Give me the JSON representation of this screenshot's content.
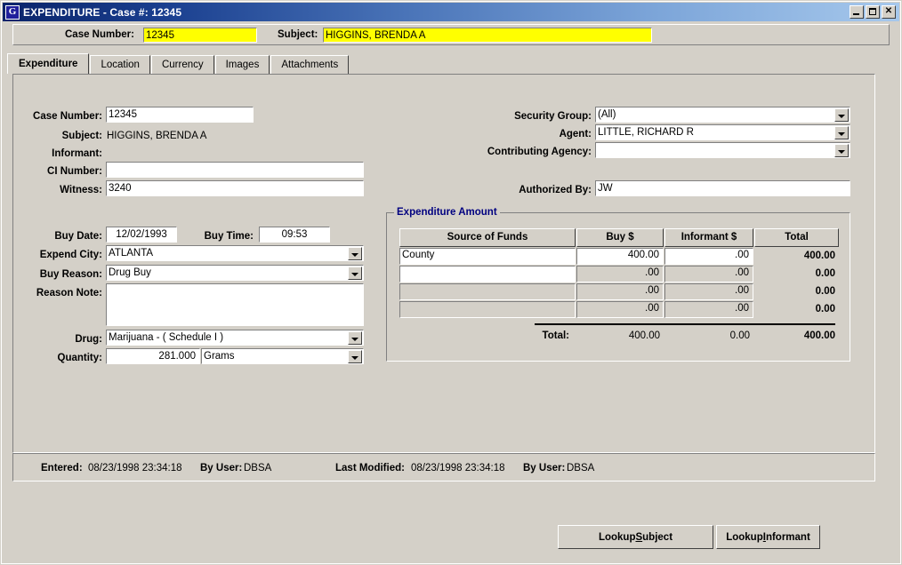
{
  "window": {
    "title": "EXPENDITURE - Case #: 12345",
    "icon": "app-g-icon",
    "minimize_label": "Minimize",
    "maximize_label": "Maximize",
    "close_label": "Close",
    "titlebar_color_left": "#0a246a",
    "titlebar_color_right": "#a6c8ec",
    "face_color": "#d4d0c8",
    "highlight_color": "#ffff00",
    "group_label_color": "#000080"
  },
  "header": {
    "case_number_label": "Case Number:",
    "case_number_value": "12345",
    "subject_label": "Subject:",
    "subject_value": "HIGGINS, BRENDA A"
  },
  "tabs": [
    {
      "label": "Expenditure",
      "active": true
    },
    {
      "label": "Location",
      "active": false
    },
    {
      "label": "Currency",
      "active": false
    },
    {
      "label": "Images",
      "active": false
    },
    {
      "label": "Attachments",
      "active": false
    }
  ],
  "form_left": {
    "case_number_label": "Case Number:",
    "case_number_value": "12345",
    "subject_label": "Subject:",
    "subject_value": "HIGGINS, BRENDA A",
    "informant_label": "Informant:",
    "informant_value": "",
    "ci_number_label": "CI Number:",
    "ci_number_value": "",
    "witness_label": "Witness:",
    "witness_value": "3240",
    "buy_date_label": "Buy Date:",
    "buy_date_value": "12/02/1993",
    "buy_time_label": "Buy Time:",
    "buy_time_value": "09:53",
    "expend_city_label": "Expend City:",
    "expend_city_value": "ATLANTA",
    "buy_reason_label": "Buy Reason:",
    "buy_reason_value": "Drug Buy",
    "reason_note_label": "Reason Note:",
    "reason_note_value": "",
    "drug_label": "Drug:",
    "drug_value": "Marijuana - ( Schedule I )",
    "quantity_label": "Quantity:",
    "quantity_value": "281.000",
    "quantity_unit_value": "Grams"
  },
  "form_right": {
    "security_group_label": "Security Group:",
    "security_group_value": "(All)",
    "agent_label": "Agent:",
    "agent_value": "LITTLE,  RICHARD R",
    "contributing_agency_label": "Contributing Agency:",
    "contributing_agency_value": "",
    "authorized_by_label": "Authorized By:",
    "authorized_by_value": "JW"
  },
  "expenditure": {
    "group_label": "Expenditure Amount",
    "columns": [
      "Source of Funds",
      "Buy $",
      "Informant $",
      "Total"
    ],
    "rows": [
      {
        "source": "County",
        "buy": "400.00",
        "informant": ".00",
        "total": "400.00",
        "source_editable": true,
        "amounts_editable": true
      },
      {
        "source": "",
        "buy": ".00",
        "informant": ".00",
        "total": "0.00",
        "source_editable": true,
        "amounts_editable": false
      },
      {
        "source": "",
        "buy": ".00",
        "informant": ".00",
        "total": "0.00",
        "source_editable": false,
        "amounts_editable": false
      },
      {
        "source": "",
        "buy": ".00",
        "informant": ".00",
        "total": "0.00",
        "source_editable": false,
        "amounts_editable": false
      }
    ],
    "total_label": "Total:",
    "total_buy": "400.00",
    "total_informant": "0.00",
    "total_total": "400.00"
  },
  "audit": {
    "entered_label": "Entered:",
    "entered_value": "08/23/1998 23:34:18",
    "entered_by_label": "By User:",
    "entered_by_value": "DBSA",
    "modified_label": "Last Modified:",
    "modified_value": "08/23/1998 23:34:18",
    "modified_by_label": "By User:",
    "modified_by_value": "DBSA"
  },
  "actions": {
    "lookup_subject_pre": "Lookup ",
    "lookup_subject_acc": "S",
    "lookup_subject_post": "ubject",
    "lookup_informant_pre": "Lookup ",
    "lookup_informant_acc": "I",
    "lookup_informant_post": "nformant"
  }
}
